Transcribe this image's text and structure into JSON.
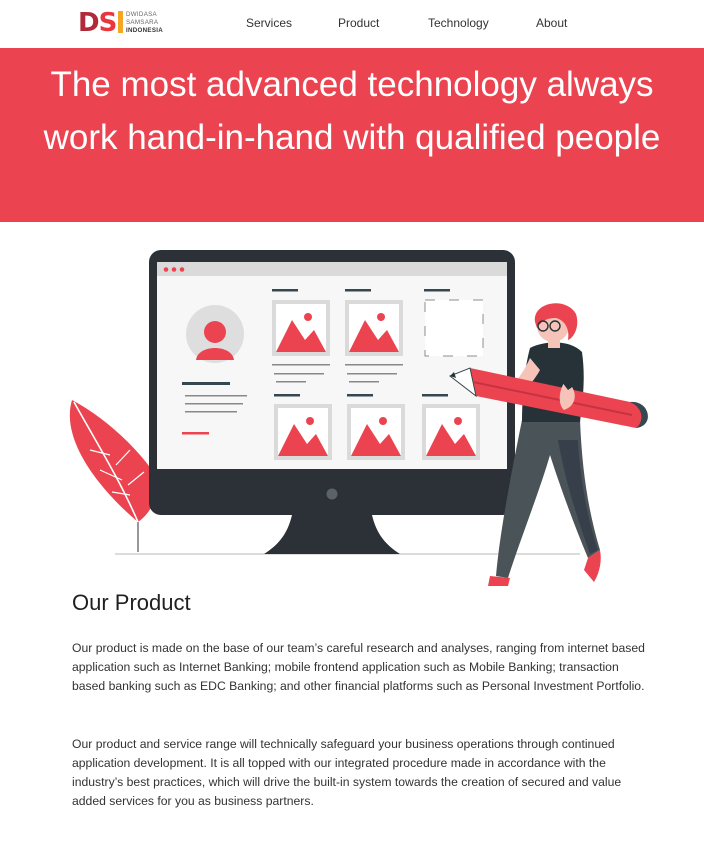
{
  "brand": {
    "logo_text": "DSI",
    "logo_words": [
      "DWIDASA",
      "SAMSARA",
      "INDONESIA"
    ],
    "colors": {
      "primary": "#eb4450",
      "dark_red": "#b22a3a",
      "accent": "#f5a623"
    }
  },
  "nav": {
    "items": [
      {
        "label": "Services"
      },
      {
        "label": "Product"
      },
      {
        "label": "Technology"
      },
      {
        "label": "About"
      }
    ]
  },
  "hero": {
    "title": "The most advanced technology always work hand-in-hand with qualified people"
  },
  "product": {
    "title": "Our Product",
    "paragraphs": [
      "Our product is made on the base of our team’s careful research and analyses, ranging from internet based application such as Internet Banking; mobile frontend application such as Mobile Banking; transaction based banking such as EDC Banking; and other financial platforms such as Personal Investment Portfolio.",
      "Our product and service range will technically safeguard your business operations through continued application development. It is all topped with our integrated procedure made in accordance with the industry’s best practices, which will drive the built-in system towards the creation of secured and value added services for you as business partners."
    ]
  },
  "illustration": {
    "icon": "monitor-with-designer-illustration"
  }
}
